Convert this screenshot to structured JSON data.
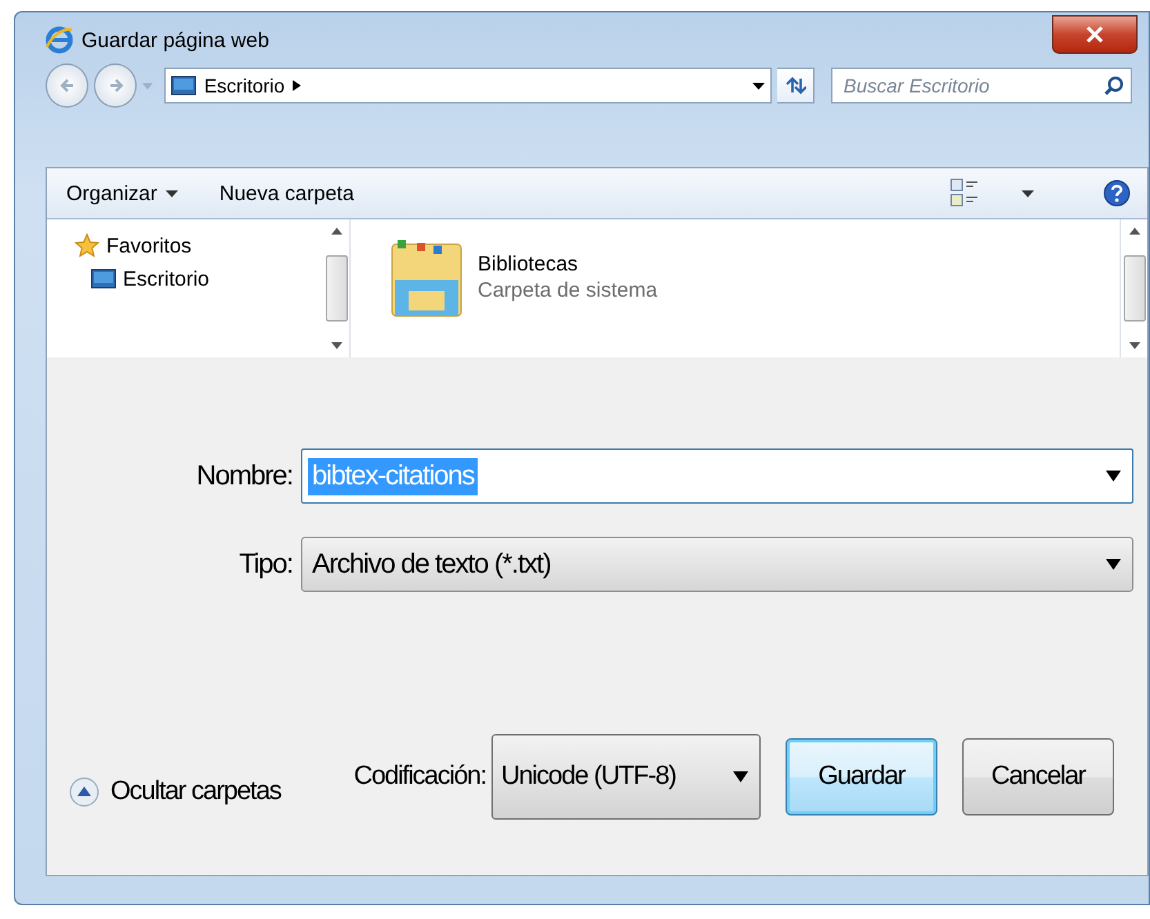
{
  "window": {
    "title": "Guardar página web"
  },
  "nav": {
    "path": "Escritorio",
    "search": {
      "placeholder": "Buscar Escritorio"
    }
  },
  "toolbar": {
    "items": [
      {
        "label": "Organizar",
        "kind": "menu"
      },
      {
        "label": "Nueva carpeta",
        "kind": "plain"
      }
    ]
  },
  "sidebar": {
    "items": [
      {
        "label": "Favoritos",
        "kind": "favorites"
      },
      {
        "label": "Escritorio",
        "kind": "desktop"
      }
    ]
  },
  "files": [
    {
      "name": "Bibliotecas",
      "detail": "Carpeta de sistema"
    }
  ],
  "form": {
    "fields": [
      {
        "label": "Nombre:",
        "value": "bibtex-citations",
        "kind": "edit",
        "selected": true
      },
      {
        "label": "Tipo:",
        "value": "Archivo de texto (*.txt)",
        "kind": "select",
        "selected": false
      }
    ]
  },
  "footer": {
    "toggle": "Ocultar carpetas",
    "encoding": {
      "label": "Codificación:",
      "value": "Unicode (UTF-8)"
    },
    "buttons": [
      {
        "label": "Guardar",
        "default": true
      },
      {
        "label": "Cancelar",
        "default": false
      }
    ]
  }
}
